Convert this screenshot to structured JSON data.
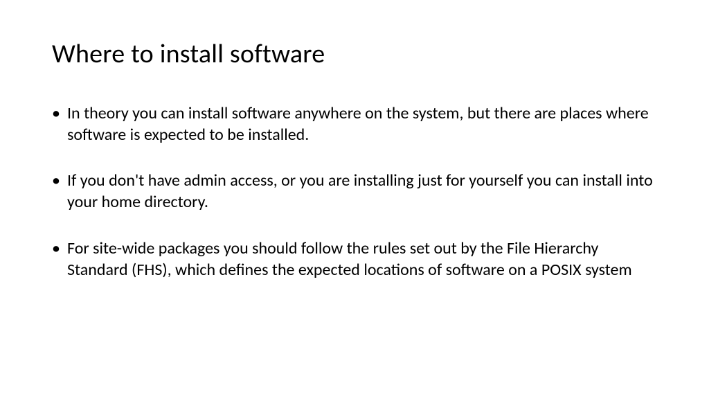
{
  "title": "Where to install software",
  "bullets": [
    "In theory you can install software anywhere on the system, but there are places where software is expected to be installed.",
    "If you don't have admin access, or you are installing just for yourself you can install into your home directory.",
    "For site-wide packages you should follow the rules set out by the File Hierarchy Standard (FHS), which defines the expected locations of software on a POSIX system"
  ]
}
